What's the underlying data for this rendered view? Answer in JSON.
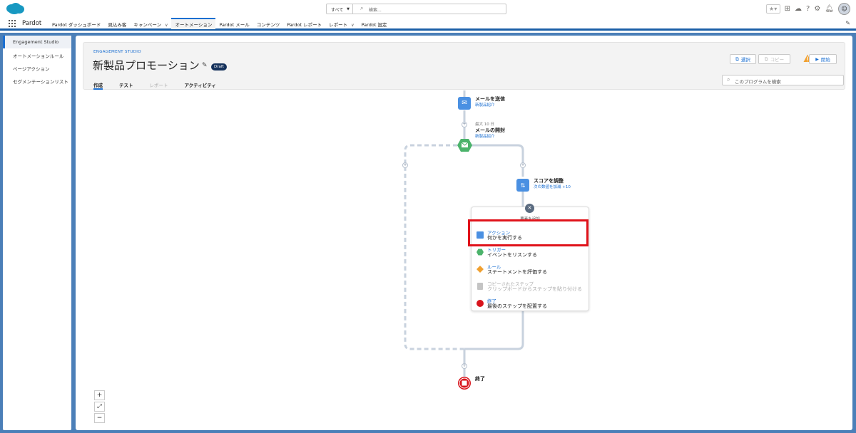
{
  "header": {
    "search_scope": "すべて",
    "search_placeholder": "検索...",
    "icons": [
      "favorites-star-icon",
      "add-icon",
      "trailhead-icon",
      "help-icon",
      "setup-gear-icon",
      "notifications-bell-icon",
      "avatar-icon"
    ]
  },
  "nav": {
    "app_name": "Pardot",
    "items": [
      {
        "label": "Pardot ダッシュボード",
        "dropdown": false
      },
      {
        "label": "見込み客",
        "dropdown": false
      },
      {
        "label": "キャンペーン",
        "dropdown": true
      },
      {
        "label": "オートメーション",
        "dropdown": false,
        "active": true
      },
      {
        "label": "Pardot メール",
        "dropdown": false
      },
      {
        "label": "コンテンツ",
        "dropdown": false
      },
      {
        "label": "Pardot レポート",
        "dropdown": false
      },
      {
        "label": "レポート",
        "dropdown": true
      },
      {
        "label": "Pardot 設定",
        "dropdown": false
      }
    ]
  },
  "sidebar": {
    "items": [
      {
        "label": "Engagement Studio",
        "active": true
      },
      {
        "label": "オートメーションルール"
      },
      {
        "label": "ページアクション"
      },
      {
        "label": "セグメンテーションリスト"
      }
    ]
  },
  "program": {
    "eyebrow": "ENGAGEMENT STUDIO",
    "title": "新製品プロモーション",
    "status_badge": "Draft",
    "tabs": [
      {
        "label": "作成",
        "state": "active"
      },
      {
        "label": "テスト",
        "state": "normal"
      },
      {
        "label": "レポート",
        "state": "disabled"
      },
      {
        "label": "アクティビティ",
        "state": "normal"
      }
    ],
    "buttons": {
      "select": "選択",
      "copy": "コピー",
      "start": "開始"
    },
    "search_placeholder": "このプログラムを検索"
  },
  "flow": {
    "send_email": {
      "title": "メールを送信",
      "sub": "新製品紹介"
    },
    "email_open": {
      "meta": "最大 10 日",
      "title": "メールの開封",
      "sub": "新製品紹介"
    },
    "adjust_score": {
      "title": "スコアを調整",
      "sub": "次の数値を加減 +10"
    },
    "end": {
      "title": "終了"
    }
  },
  "add_element": {
    "title": "要素を追加",
    "items": [
      {
        "name": "action",
        "line1": "アクション",
        "line2": "何かを実行する",
        "color": "#4a90e2"
      },
      {
        "name": "trigger",
        "line1": "トリガー",
        "line2": "イベントをリスンする",
        "color": "#4bb36b"
      },
      {
        "name": "rule",
        "line1": "ルール",
        "line2": "ステートメントを評価する",
        "color": "#f0a030"
      },
      {
        "name": "copied-step",
        "line1": "コピーされたステップ",
        "line2": "クリップボードからステップを貼り付ける",
        "color": "#bbbbbb",
        "disabled": true
      },
      {
        "name": "end",
        "line1": "終了",
        "line2": "最後のステップを配置する",
        "color": "#d8141c"
      }
    ]
  },
  "zoom": {
    "in": "+",
    "fit": "⤢",
    "out": "−"
  },
  "colors": {
    "accent": "#1b6fd1",
    "brand_bg": "#4b7fb8",
    "highlight": "#e0121a"
  }
}
